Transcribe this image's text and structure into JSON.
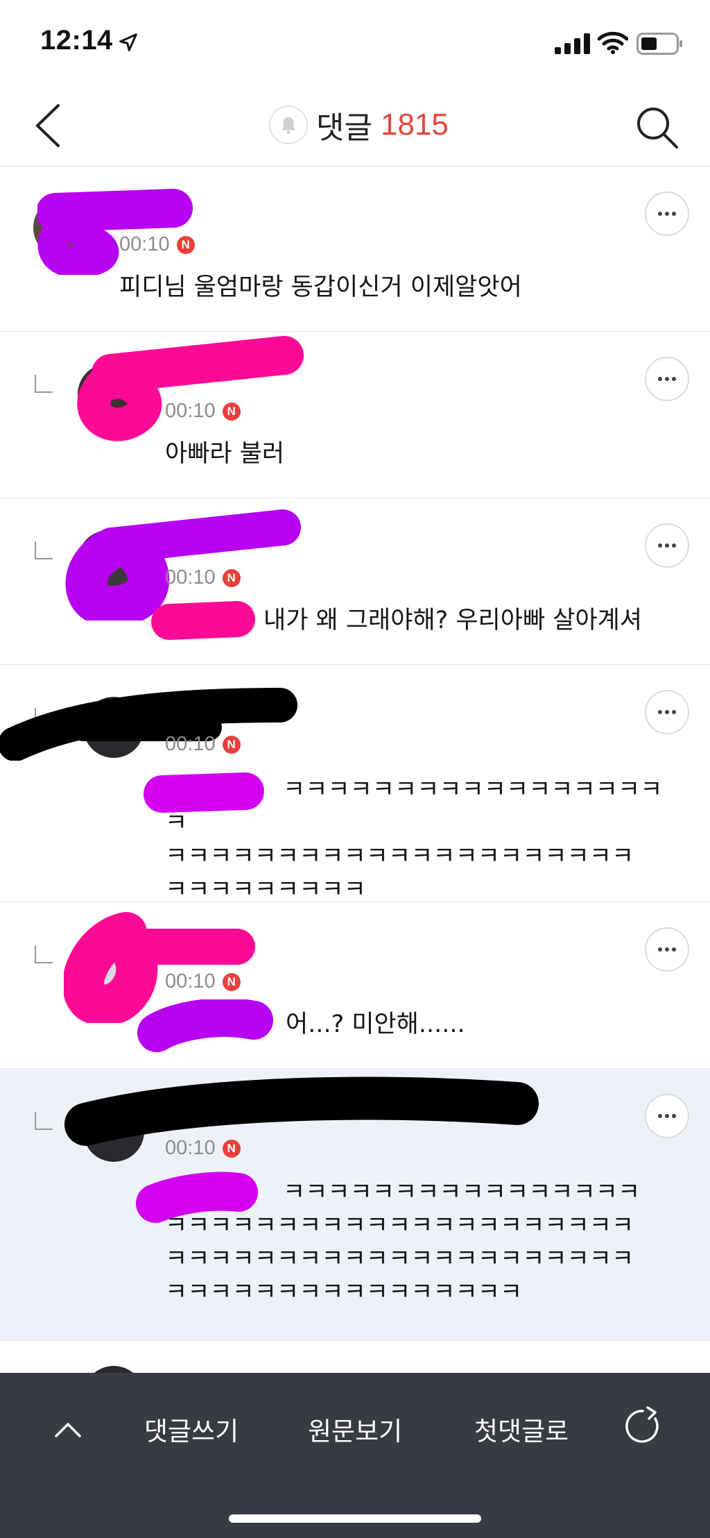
{
  "status_bar": {
    "time": "12:14"
  },
  "header": {
    "title": "댓글",
    "count": "1815"
  },
  "comments": [
    {
      "time": "00:10",
      "badge": "N",
      "text": "피디님 울엄마랑 동갑이신거 이제알앗어"
    },
    {
      "time": "00:10",
      "badge": "N",
      "text": "아빠라 불러"
    },
    {
      "time": "00:10",
      "badge": "N",
      "text": "내가 왜 그래야해? 우리아빠 살아계셔"
    },
    {
      "time": "00:10",
      "badge": "N",
      "text": "ㅋㅋㅋㅋㅋㅋㅋㅋㅋㅋㅋㅋㅋㅋㅋㅋㅋㅋ\nㅋㅋㅋㅋㅋㅋㅋㅋㅋㅋㅋㅋㅋㅋㅋㅋㅋㅋㅋㅋㅋ\nㅋㅋㅋㅋㅋㅋㅋㅋㅋ"
    },
    {
      "time": "00:10",
      "badge": "N",
      "text": "어...? 미안해......"
    },
    {
      "time": "00:10",
      "badge": "N",
      "text": "ㅋㅋㅋㅋㅋㅋㅋㅋㅋㅋㅋㅋㅋㅋㅋㅋ\nㅋㅋㅋㅋㅋㅋㅋㅋㅋㅋㅋㅋㅋㅋㅋㅋㅋㅋㅋㅋㅋ\nㅋㅋㅋㅋㅋㅋㅋㅋㅋㅋㅋㅋㅋㅋㅋㅋㅋㅋㅋㅋㅋ\nㅋㅋㅋㅋㅋㅋㅋㅋㅋㅋㅋㅋㅋㅋㅋㅋ"
    }
  ],
  "toolbar": {
    "write": "댓글쓰기",
    "original": "원문보기",
    "first": "첫댓글로"
  },
  "icons": [
    "location-arrow-icon",
    "signal-icon",
    "wifi-icon",
    "battery-icon",
    "back-icon",
    "bell-icon",
    "search-icon",
    "more-icon",
    "chevron-up-icon",
    "refresh-icon"
  ],
  "colors": {
    "accent": "#e5463c",
    "toolbar_bg": "#383b42",
    "highlight_bg": "#eef2f8",
    "badge": "#e8403c"
  }
}
